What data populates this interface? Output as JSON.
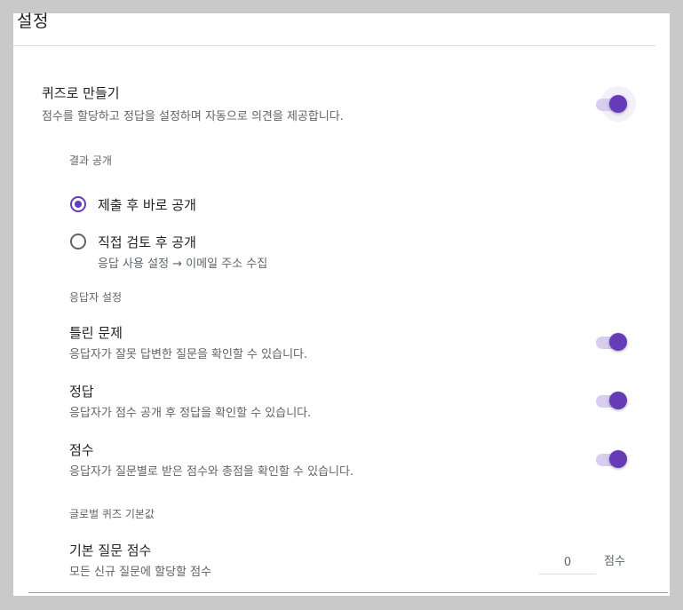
{
  "header": {
    "title": "설정"
  },
  "quiz": {
    "heading": "퀴즈로 만들기",
    "description": "점수를 할당하고 정답을 설정하며 자동으로 의견을 제공합니다.",
    "enabled": true
  },
  "release": {
    "section_label": "결과 공개",
    "options": [
      {
        "label": "제출 후 바로 공개",
        "checked": true
      },
      {
        "label": "직접 검토 후 공개",
        "sublabel": "응답 사용 설정 → 이메일 주소 수집",
        "checked": false
      }
    ]
  },
  "respondent": {
    "section_label": "응답자 설정",
    "items": [
      {
        "heading": "틀린 문제",
        "description": "응답자가 잘못 답변한 질문을 확인할 수 있습니다.",
        "enabled": true
      },
      {
        "heading": "정답",
        "description": "응답자가 점수 공개 후 정답을 확인할 수 있습니다.",
        "enabled": true
      },
      {
        "heading": "점수",
        "description": "응답자가 질문별로 받은 점수와 총점을 확인할 수 있습니다.",
        "enabled": true
      }
    ]
  },
  "defaults": {
    "section_label": "글로벌 퀴즈 기본값",
    "heading": "기본 질문 점수",
    "description": "모든 신규 질문에 할당할 점수",
    "value": "0",
    "unit": "점수"
  },
  "colors": {
    "accent": "#673ab7",
    "track": "#d7cdef",
    "backdrop": "#c9c9c9"
  }
}
